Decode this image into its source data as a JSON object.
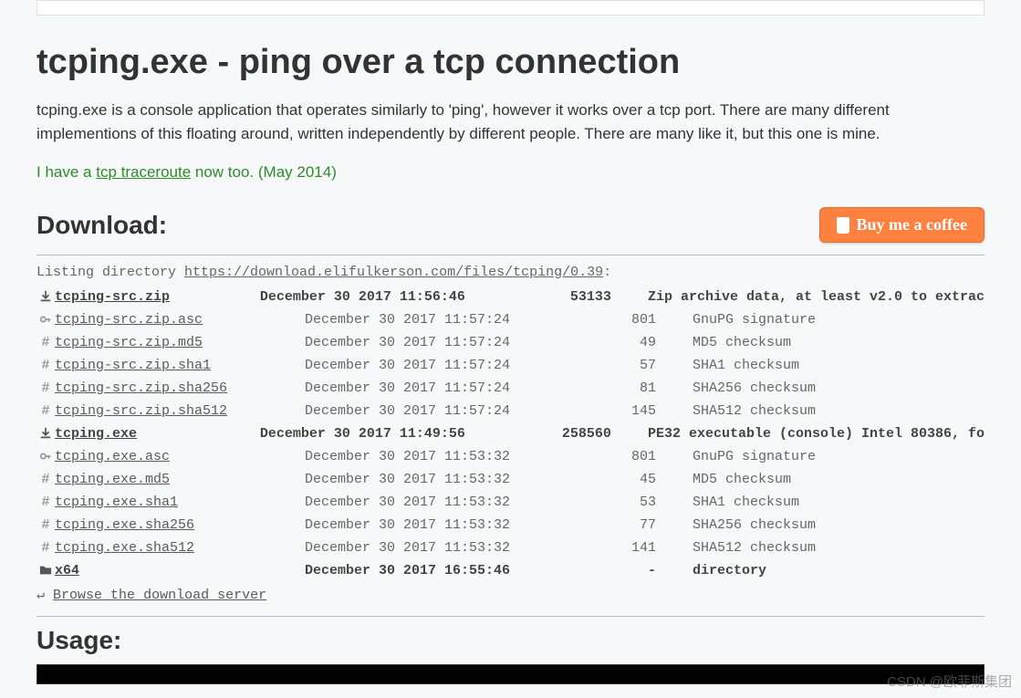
{
  "title": "tcping.exe - ping over a tcp connection",
  "intro": "tcping.exe is a console application that operates similarly to 'ping', however it works over a tcp port. There are many different implementions of this floating around, written independently by different people. There are many like it, but this one is mine.",
  "traceroute": {
    "prefix": "I have a ",
    "link": "tcp traceroute",
    "suffix": " now too. (May 2014)"
  },
  "download_heading": "Download:",
  "coffee_label": "Buy me a coffee",
  "listing_prefix": "Listing directory ",
  "listing_url": "https://download.elifulkerson.com/files/tcping/0.39",
  "listing_suffix": ":",
  "files": [
    {
      "icon": "download",
      "bold": true,
      "name": "tcping-src.zip",
      "date": "December 30 2017 11:56:46",
      "size": "53133",
      "desc": "Zip archive data, at least v2.0 to extrac"
    },
    {
      "icon": "key",
      "bold": false,
      "name": "tcping-src.zip.asc",
      "date": "December 30 2017 11:57:24",
      "size": "801",
      "desc": "GnuPG signature"
    },
    {
      "icon": "hash",
      "bold": false,
      "name": "tcping-src.zip.md5",
      "date": "December 30 2017 11:57:24",
      "size": "49",
      "desc": "MD5 checksum"
    },
    {
      "icon": "hash",
      "bold": false,
      "name": "tcping-src.zip.sha1",
      "date": "December 30 2017 11:57:24",
      "size": "57",
      "desc": "SHA1 checksum"
    },
    {
      "icon": "hash",
      "bold": false,
      "name": "tcping-src.zip.sha256",
      "date": "December 30 2017 11:57:24",
      "size": "81",
      "desc": "SHA256 checksum"
    },
    {
      "icon": "hash",
      "bold": false,
      "name": "tcping-src.zip.sha512",
      "date": "December 30 2017 11:57:24",
      "size": "145",
      "desc": "SHA512 checksum"
    },
    {
      "icon": "download",
      "bold": true,
      "name": "tcping.exe",
      "date": "December 30 2017 11:49:56",
      "size": "258560",
      "desc": "PE32 executable (console) Intel 80386, fo"
    },
    {
      "icon": "key",
      "bold": false,
      "name": "tcping.exe.asc",
      "date": "December 30 2017 11:53:32",
      "size": "801",
      "desc": "GnuPG signature"
    },
    {
      "icon": "hash",
      "bold": false,
      "name": "tcping.exe.md5",
      "date": "December 30 2017 11:53:32",
      "size": "45",
      "desc": "MD5 checksum"
    },
    {
      "icon": "hash",
      "bold": false,
      "name": "tcping.exe.sha1",
      "date": "December 30 2017 11:53:32",
      "size": "53",
      "desc": "SHA1 checksum"
    },
    {
      "icon": "hash",
      "bold": false,
      "name": "tcping.exe.sha256",
      "date": "December 30 2017 11:53:32",
      "size": "77",
      "desc": "SHA256 checksum"
    },
    {
      "icon": "hash",
      "bold": false,
      "name": "tcping.exe.sha512",
      "date": "December 30 2017 11:53:32",
      "size": "141",
      "desc": "SHA512 checksum"
    },
    {
      "icon": "folder",
      "bold": true,
      "name": "x64",
      "date": "December 30 2017 16:55:46",
      "size": "-",
      "desc": "directory"
    }
  ],
  "browse_label": "Browse the download server",
  "usage_heading": "Usage:",
  "watermark": "CSDN @欧菲斯集团"
}
